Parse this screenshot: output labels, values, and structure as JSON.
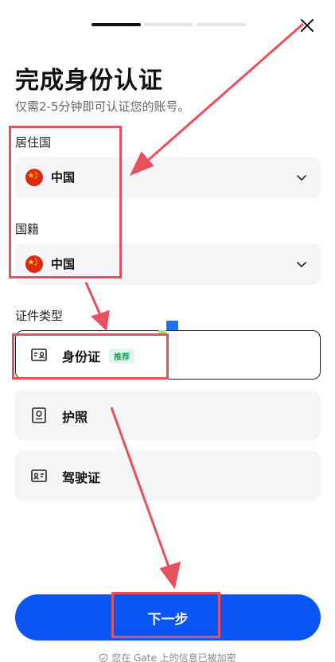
{
  "progress": {
    "steps": 3,
    "current": 1
  },
  "header": {
    "title": "完成身份认证",
    "subtitle": "仅需2-5分钟即可认证您的账号。"
  },
  "residence": {
    "label": "居住国",
    "value": "中国",
    "flag_icon": "china-flag-icon"
  },
  "nationality": {
    "label": "国籍",
    "value": "中国",
    "flag_icon": "china-flag-icon"
  },
  "document_type": {
    "label": "证件类型",
    "options": [
      {
        "name": "身份证",
        "badge": "推荐",
        "icon": "id-card-icon",
        "selected": true
      },
      {
        "name": "护照",
        "icon": "passport-icon",
        "selected": false
      },
      {
        "name": "驾驶证",
        "icon": "driver-license-icon",
        "selected": false
      }
    ]
  },
  "actions": {
    "next_label": "下一步"
  },
  "footer": {
    "security_text": "您在 Gate 上的信息已被加密"
  },
  "colors": {
    "primary": "#0a55f5",
    "annotation": "#e8505b",
    "recommend": "#17a858"
  }
}
